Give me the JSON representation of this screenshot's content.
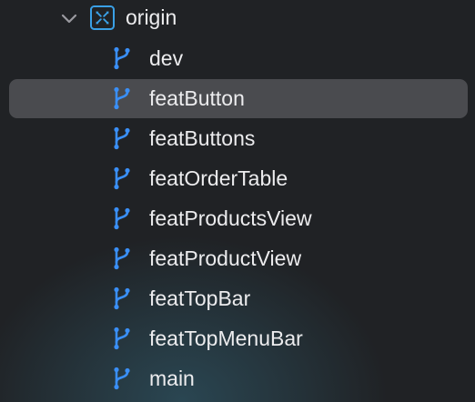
{
  "colors": {
    "background": "#202225",
    "glow": "#2a4652",
    "selection": "#4a4b4f",
    "branch_icon": "#3a8ff7",
    "remote_icon": "#3aa0e6",
    "text": "#ececee",
    "disclosure": "#9a9aa0"
  },
  "remote": {
    "label": "origin",
    "expanded": true,
    "disclosure_icon": "chevron-down-icon",
    "icon": "remote-repository-icon"
  },
  "branches": [
    {
      "label": "dev",
      "icon": "git-branch-icon",
      "selected": false
    },
    {
      "label": "featButton",
      "icon": "git-branch-icon",
      "selected": true
    },
    {
      "label": "featButtons",
      "icon": "git-branch-icon",
      "selected": false
    },
    {
      "label": "featOrderTable",
      "icon": "git-branch-icon",
      "selected": false
    },
    {
      "label": "featProductsView",
      "icon": "git-branch-icon",
      "selected": false
    },
    {
      "label": "featProductView",
      "icon": "git-branch-icon",
      "selected": false
    },
    {
      "label": "featTopBar",
      "icon": "git-branch-icon",
      "selected": false
    },
    {
      "label": "featTopMenuBar",
      "icon": "git-branch-icon",
      "selected": false
    },
    {
      "label": "main",
      "icon": "git-branch-icon",
      "selected": false
    }
  ]
}
